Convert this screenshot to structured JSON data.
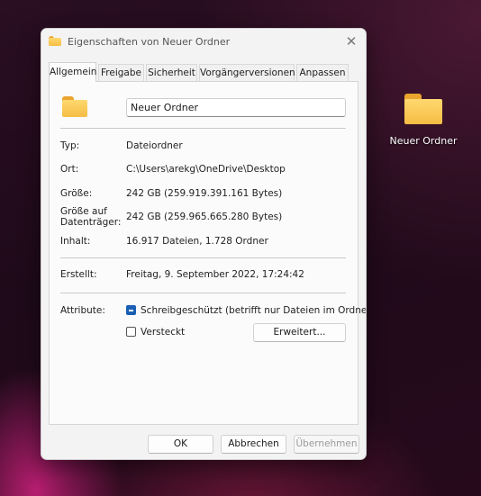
{
  "desktop": {
    "folder_label": "Neuer Ordner"
  },
  "dialog": {
    "title": "Eigenschaften von Neuer Ordner",
    "close_glyph": "✕",
    "tabs": [
      {
        "label": "Allgemein",
        "active": true
      },
      {
        "label": "Freigabe"
      },
      {
        "label": "Sicherheit"
      },
      {
        "label": "Vorgängerversionen"
      },
      {
        "label": "Anpassen"
      }
    ],
    "general": {
      "name_value": "Neuer Ordner",
      "typ_label": "Typ:",
      "typ_value": "Dateiordner",
      "ort_label": "Ort:",
      "ort_value": "C:\\Users\\arekg\\OneDrive\\Desktop",
      "groesse_label": "Größe:",
      "groesse_value": "242 GB (259.919.391.161 Bytes)",
      "groesse_datentraeger_label_1": "Größe auf",
      "groesse_datentraeger_label_2": "Datenträger:",
      "groesse_datentraeger_value": "242 GB (259.965.665.280 Bytes)",
      "inhalt_label": "Inhalt:",
      "inhalt_value": "16.917 Dateien, 1.728 Ordner",
      "erstellt_label": "Erstellt:",
      "erstellt_value": "Freitag, 9. September 2022, 17:24:42",
      "attribute_label": "Attribute:",
      "schreibgeschuetzt_label": "Schreibgeschützt (betrifft nur Dateien im Ordner)",
      "schreibgeschuetzt_state": "indeterminate",
      "versteckt_label": "Versteckt",
      "versteckt_state": "unchecked",
      "erweitert_label": "Erweitert..."
    },
    "buttons": {
      "ok": "OK",
      "cancel": "Abbrechen",
      "apply": "Übernehmen"
    }
  },
  "colors": {
    "folder_yellow": "#f5bd44",
    "checkbox_accent": "#1a5fb4"
  }
}
